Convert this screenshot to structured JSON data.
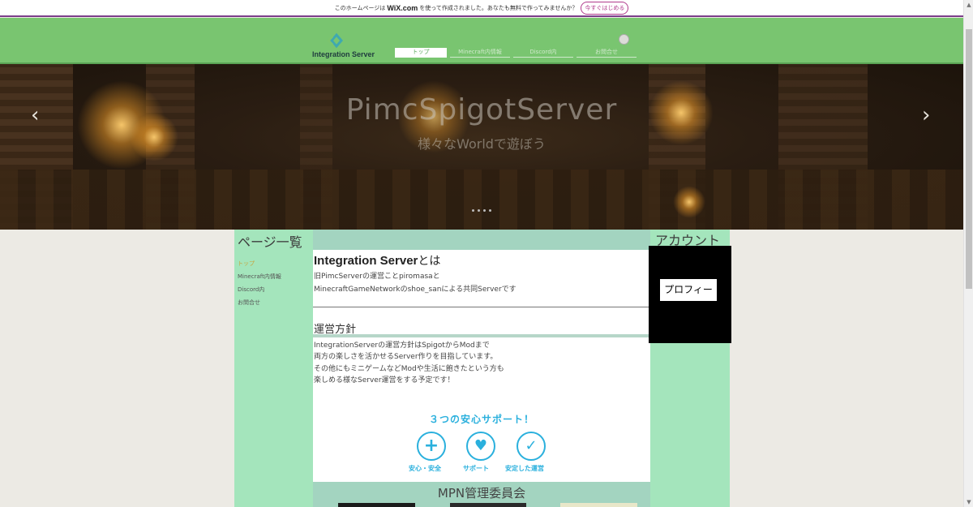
{
  "wix_bar": {
    "message_before": "このホームページは",
    "brand": "WiX.com",
    "message_after": "を使って作成されました。あなたも無料で作ってみませんか？",
    "cta": "今すぐはじめる"
  },
  "header": {
    "logo_text": "Integration Server",
    "nav": [
      {
        "label": "トップ",
        "active": true
      },
      {
        "label": "Minecraft内情報",
        "active": false
      },
      {
        "label": "Discord内",
        "active": false
      },
      {
        "label": "お問合せ",
        "active": false
      }
    ]
  },
  "hero": {
    "title": "PimcSpigotServer",
    "subtitle": "様々なWorldで遊ぼう",
    "prev": "‹",
    "next": "›",
    "slide_count": 4
  },
  "left_sidebar": {
    "heading": "ページ一覧",
    "links": [
      "トップ",
      "Minecraft内情報",
      "Discord内",
      "お問合せ"
    ]
  },
  "main": {
    "intro_title_bold": "Integration Server",
    "intro_title_rest": "とは",
    "intro_lines": [
      "旧PimcServerの運営ことpiromasaと",
      "MinecraftGameNetworkのshoe_sanによる共同Serverです"
    ],
    "policy_title": "運営方針",
    "policy_lines": [
      "IntegrationServerの運営方針はSpigotからModまで",
      "両方の楽しさを活かせるServer作りを目指しています。",
      "その他にもミニゲームなどModや生活に飽きたという方も",
      "楽しめる様なServer運営をする予定です！"
    ],
    "support_title": "３つの安心サポート！",
    "support_items": [
      {
        "icon": "plus-icon",
        "label": "安心・安全"
      },
      {
        "icon": "heart-icon",
        "label": "サポート"
      },
      {
        "icon": "check-icon",
        "label": "安定した運営"
      }
    ],
    "committee_title": "MPN管理委員会"
  },
  "right_sidebar": {
    "heading": "アカウント",
    "profile_button": "プロフィール"
  },
  "colors": {
    "header_green": "#79c570",
    "sidebar_mint": "#a4e5bc",
    "band_teal": "#a3d4c0",
    "support_blue": "#2ab0dd"
  }
}
